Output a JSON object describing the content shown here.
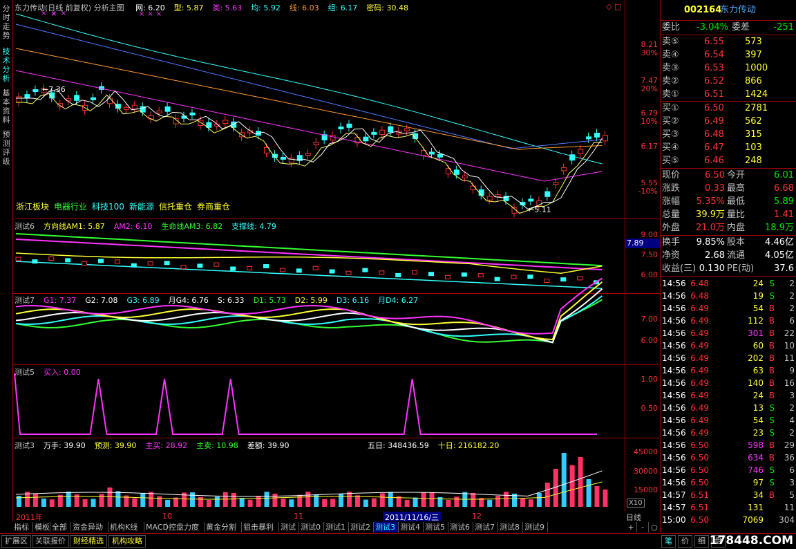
{
  "window": {
    "title": "东力传动(日线 前复权) 分析主图"
  },
  "left_tabs": [
    "分时走势",
    "技术分析",
    "基本资料",
    "预测评级"
  ],
  "main_legend": [
    {
      "label": "网: 6.20",
      "color": "#ffffff"
    },
    {
      "label": "型: 5.87",
      "color": "#ffff33"
    },
    {
      "label": "类: 5.63",
      "color": "#ff33ff"
    },
    {
      "label": "均: 5.92",
      "color": "#33ffff"
    },
    {
      "label": "线: 6.03",
      "color": "#ff9933"
    },
    {
      "label": "组: 6.17",
      "color": "#33ffff"
    },
    {
      "label": "密码: 30.48",
      "color": "#ffff33"
    }
  ],
  "main_annotations": {
    "high_label": "7.36",
    "low_label": "5.11"
  },
  "sector_tags": [
    {
      "label": "浙江板块",
      "color": "#ffff33"
    },
    {
      "label": "电器行业",
      "color": "#33ff33"
    },
    {
      "label": "科技100",
      "color": "#33ffff"
    },
    {
      "label": "新能源",
      "color": "#33ffff"
    },
    {
      "label": "信托重仓",
      "color": "#ffff33"
    },
    {
      "label": "券商重仓",
      "color": "#ffff33"
    }
  ],
  "main_scale": [
    {
      "price": "8.21",
      "pct": "30%"
    },
    {
      "price": "7.47",
      "pct": "20%"
    },
    {
      "price": "6.79",
      "pct": "10%"
    },
    {
      "price": "6.17",
      "pct": ""
    },
    {
      "price": "5.55",
      "pct": "-10%"
    }
  ],
  "panel6": {
    "title": "测试6",
    "items": [
      {
        "label": "方向线AM1: 5.87",
        "color": "#ffff33"
      },
      {
        "label": "AM2: 6.10",
        "color": "#ff33ff"
      },
      {
        "label": "生命线AM3: 6.82",
        "color": "#33ff33"
      },
      {
        "label": "支撑线: 4.79",
        "color": "#33ffff"
      }
    ],
    "scale": [
      "9.00",
      "7.50",
      "6.00"
    ],
    "current": "7.89"
  },
  "panel7": {
    "title": "测试7",
    "items": [
      {
        "label": "G1: 7.37",
        "color": "#ff33ff"
      },
      {
        "label": "G2: 7.08",
        "color": "#ffffff"
      },
      {
        "label": "G3: 6.89",
        "color": "#33ffff"
      },
      {
        "label": "月G4: 6.76",
        "color": "#ffffff"
      },
      {
        "label": "S: 6.33",
        "color": "#ffffff"
      },
      {
        "label": "D1: 5.73",
        "color": "#33ff33"
      },
      {
        "label": "D2: 5.99",
        "color": "#ffff33"
      },
      {
        "label": "D3: 6.16",
        "color": "#33ffff"
      },
      {
        "label": "月D4: 6.27",
        "color": "#33ffff"
      }
    ],
    "scale": [
      "7.00",
      "6.00"
    ]
  },
  "panel5": {
    "title": "测试5",
    "items": [
      {
        "label": "买入: 0.00",
        "color": "#ff33ff"
      }
    ],
    "scale": [
      "1.00",
      "0.50"
    ]
  },
  "panel3": {
    "title": "测试3",
    "items": [
      {
        "label": "万手: 39.90",
        "color": "#ffffff"
      },
      {
        "label": "预测: 39.90",
        "color": "#ffff33"
      },
      {
        "label": "主买: 28.92",
        "color": "#ff33ff"
      },
      {
        "label": "主卖: 10.98",
        "color": "#33ff33"
      },
      {
        "label": "差额: 39.90",
        "color": "#ffffff"
      }
    ],
    "extra": [
      {
        "label": "五日: 348436.59",
        "color": "#ffffff"
      },
      {
        "label": "十日: 216182.20",
        "color": "#ffff33"
      }
    ],
    "scale": [
      "45000",
      "30000",
      "15000"
    ],
    "unit": "X10"
  },
  "date_axis": {
    "labels": [
      "2011年",
      "10",
      "11",
      "12"
    ],
    "cursor": "2011/11/16/三",
    "period": "日线"
  },
  "bottom_tabs": [
    "指标",
    "模板",
    "全部",
    "资金异动",
    "机构K线",
    "MACD",
    "控盘力度",
    "黄金分割",
    "狙击暴利",
    "测试",
    "测试0",
    "测试1",
    "测试2",
    "测试3",
    "测试4",
    "测试5",
    "测试6",
    "测试7",
    "测试8",
    "测试9"
  ],
  "bottom_tab_active": "测试3",
  "nav_buttons": [
    "+",
    "-",
    "○"
  ],
  "status_tabs": [
    "扩展区",
    "关联报价",
    "财经精选",
    "机构攻略"
  ],
  "side_tabs": [
    "笔",
    "价",
    "细",
    "盘"
  ],
  "watermark": "178448.COM",
  "quote": {
    "code": "002164",
    "name": "东力传动",
    "weibi_label": "委比",
    "weibi": "-3.04%",
    "weicha_label": "委差",
    "weicha": "-251",
    "sells": [
      {
        "label": "卖⑤",
        "price": "6.55",
        "vol": "573"
      },
      {
        "label": "卖④",
        "price": "6.54",
        "vol": "397"
      },
      {
        "label": "卖③",
        "price": "6.53",
        "vol": "1000"
      },
      {
        "label": "卖②",
        "price": "6.52",
        "vol": "866"
      },
      {
        "label": "卖①",
        "price": "6.51",
        "vol": "1424"
      }
    ],
    "buys": [
      {
        "label": "买①",
        "price": "6.50",
        "vol": "2781"
      },
      {
        "label": "买②",
        "price": "6.49",
        "vol": "562"
      },
      {
        "label": "买③",
        "price": "6.48",
        "vol": "315"
      },
      {
        "label": "买④",
        "price": "6.47",
        "vol": "103"
      },
      {
        "label": "买⑤",
        "price": "6.46",
        "vol": "248"
      }
    ],
    "stats": [
      {
        "l1": "现价",
        "v1": "6.50",
        "c1": "#ff3333",
        "l2": "今开",
        "v2": "6.01",
        "c2": "#00e600"
      },
      {
        "l1": "涨跌",
        "v1": "0.33",
        "c1": "#ff3333",
        "l2": "最高",
        "v2": "6.68",
        "c2": "#ff3333"
      },
      {
        "l1": "涨幅",
        "v1": "5.35%",
        "c1": "#ff3333",
        "l2": "最低",
        "v2": "5.89",
        "c2": "#00e600"
      },
      {
        "l1": "总量",
        "v1": "39.9万",
        "c1": "#ffff33",
        "l2": "量比",
        "v2": "1.41",
        "c2": "#ff3333"
      },
      {
        "l1": "外盘",
        "v1": "21.0万",
        "c1": "#ff3333",
        "l2": "内盘",
        "v2": "18.9万",
        "c2": "#00e600"
      }
    ],
    "stats2": [
      {
        "l1": "换手",
        "v1": "9.85%",
        "l2": "股本",
        "v2": "4.46亿"
      },
      {
        "l1": "净资",
        "v1": "2.68",
        "l2": "流通",
        "v2": "4.05亿"
      },
      {
        "l1": "收益(三)",
        "v1": "0.130",
        "l2": "PE(动)",
        "v2": "37.6"
      }
    ],
    "ticks": [
      {
        "t": "14:56",
        "p": "6.48",
        "v": "24",
        "bs": "S",
        "n": "2"
      },
      {
        "t": "14:56",
        "p": "6.48",
        "v": "19",
        "bs": "S",
        "n": "2"
      },
      {
        "t": "14:56",
        "p": "6.49",
        "v": "54",
        "bs": "B",
        "n": "2"
      },
      {
        "t": "14:56",
        "p": "6.49",
        "v": "112",
        "bs": "B",
        "n": "6"
      },
      {
        "t": "14:56",
        "p": "6.49",
        "v": "301",
        "bs": "B",
        "n": "22"
      },
      {
        "t": "14:56",
        "p": "6.49",
        "v": "60",
        "bs": "B",
        "n": "10"
      },
      {
        "t": "14:56",
        "p": "6.49",
        "v": "202",
        "bs": "B",
        "n": "11"
      },
      {
        "t": "14:56",
        "p": "6.49",
        "v": "63",
        "bs": "B",
        "n": "9"
      },
      {
        "t": "14:56",
        "p": "6.49",
        "v": "140",
        "bs": "B",
        "n": "16"
      },
      {
        "t": "14:56",
        "p": "6.49",
        "v": "24",
        "bs": "B",
        "n": "3"
      },
      {
        "t": "14:56",
        "p": "6.49",
        "v": "13",
        "bs": "S",
        "n": "2"
      },
      {
        "t": "14:56",
        "p": "6.49",
        "v": "54",
        "bs": "S",
        "n": "4"
      },
      {
        "t": "14:56",
        "p": "6.49",
        "v": "23",
        "bs": "S",
        "n": "2"
      },
      {
        "t": "14:56",
        "p": "6.50",
        "v": "598",
        "bs": "B",
        "n": "29"
      },
      {
        "t": "14:56",
        "p": "6.50",
        "v": "634",
        "bs": "B",
        "n": "36"
      },
      {
        "t": "14:56",
        "p": "6.50",
        "v": "746",
        "bs": "S",
        "n": "6"
      },
      {
        "t": "14:56",
        "p": "6.50",
        "v": "97",
        "bs": "S",
        "n": "3"
      },
      {
        "t": "14:57",
        "p": "6.51",
        "v": "34",
        "bs": "B",
        "n": "5"
      },
      {
        "t": "14:57",
        "p": "6.51",
        "v": "131",
        "bs": "",
        "n": "11"
      },
      {
        "t": "15:00",
        "p": "6.50",
        "v": "7069",
        "bs": "",
        "n": "304"
      }
    ]
  }
}
